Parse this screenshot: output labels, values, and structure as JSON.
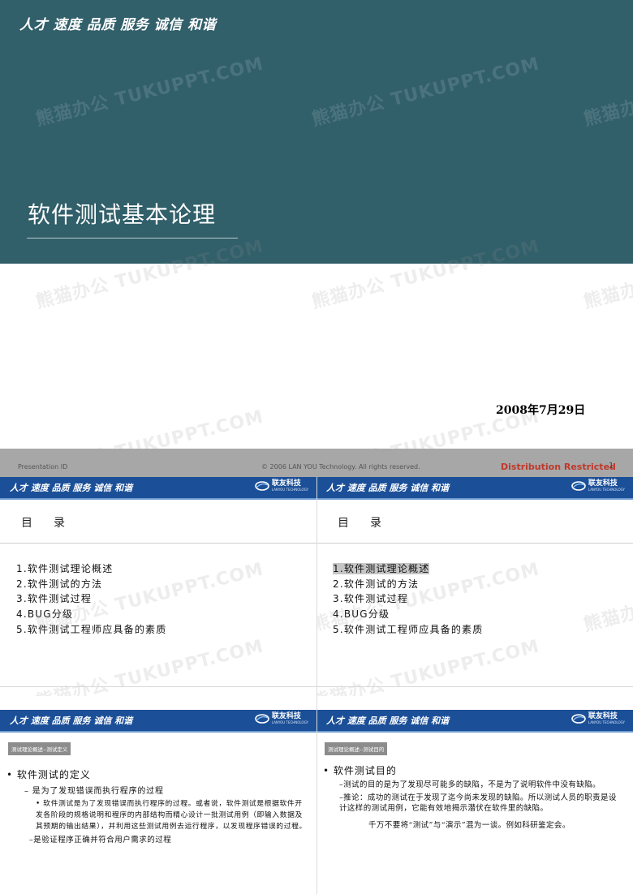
{
  "cover": {
    "slogan": "人才 速度 品质 服务 诚信 和谐",
    "title": "软件测试基本论理",
    "date": "2008年7月29日"
  },
  "footer": {
    "left": "Presentation   ID",
    "center": "© 2006 LAN YOU Technology. All rights reserved.",
    "right": "Distribution  Restricted",
    "page": "1"
  },
  "header": {
    "slogan": "人才 速度 品质 服务 诚信 和谐",
    "logo_text": "联友科技",
    "logo_sub": "LANYOU TECHNOLOGY"
  },
  "toc": {
    "title": "目录",
    "items": [
      "1.软件测试理论概述",
      "2.软件测试的方法",
      "3.软件测试过程",
      "4.BUG分级",
      "5.软件测试工程师应具备的素质"
    ]
  },
  "slide_definition": {
    "tag": "测试理论概述--测试定义",
    "heading": "• 软件测试的定义",
    "point1": "– 是为了发现错误而执行程序的过程",
    "detail": "• 软件测试是为了发现错误而执行程序的过程。或者说，软件测试是根据软件开发各阶段的规格说明和程序的内部结构而精心设计一批测试用例（即输入数据及其预期的输出结果），并利用这些测试用例去运行程序，以发现程序错误的过程。",
    "point2": "–是验证程序正确并符合用户需求的过程"
  },
  "slide_purpose": {
    "tag": "测试理论概述--测试目的",
    "heading": "• 软件测试目的",
    "point1": "–测试的目的是为了发现尽可能多的缺陷，不是为了说明软件中没有缺陷。",
    "point2": "–推论：成功的测试在于发现了迄今尚未发现的缺陷。所以测试人员的职责是设计这样的测试用例，它能有效地揭示潜伏在软件里的缺陷。",
    "note": "千万不要将“测试”与“演示”混为一谈。例如科研鉴定会。"
  },
  "watermark": "熊猫办公 TUKUPPT.COM",
  "colors": {
    "cover_band": "#315f6a",
    "header_blue": "#1b4f98",
    "footer_gray": "#a7a7a7",
    "restricted_red": "#c0392b",
    "highlight": "#c6c6c6"
  }
}
